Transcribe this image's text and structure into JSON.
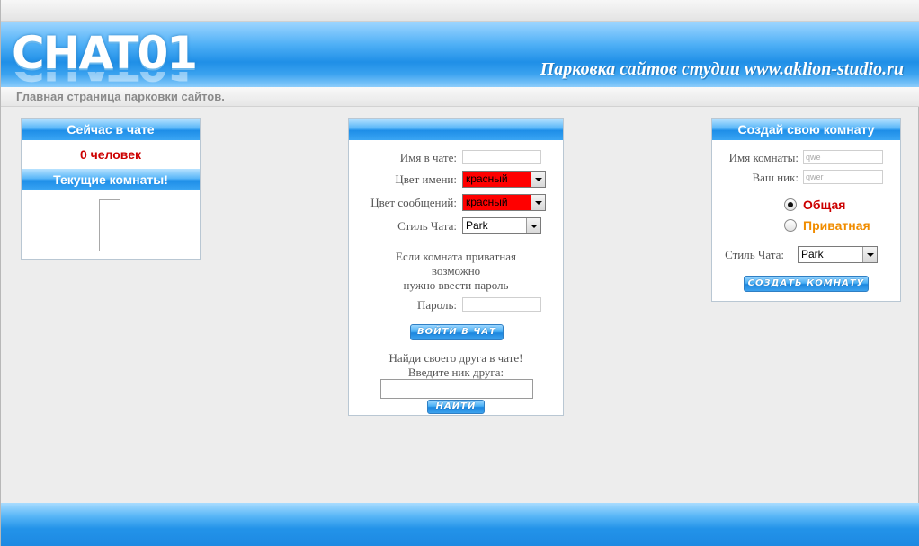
{
  "header": {
    "logo": "CHAT01",
    "slogan": "Парковка сайтов студии www.aklion-studio.ru"
  },
  "subbar": {
    "text": "Главная страница парковки сайтов."
  },
  "left": {
    "now_title": "Сейчас в чате",
    "count": "0 человек",
    "rooms_title": "Текущие комнаты!"
  },
  "center": {
    "title": "",
    "name_label": "Имя в чате:",
    "name_value": "",
    "name_color_label": "Цвет имени:",
    "name_color_value": "красный",
    "msg_color_label": "Цвет сообщений:",
    "msg_color_value": "красный",
    "style_label": "Стиль Чата:",
    "style_value": "Park",
    "private_note_1": "Если комната приватная",
    "private_note_2": "возможно",
    "private_note_3": "нужно ввести пароль",
    "password_label": "Пароль:",
    "enter_button": "ВОЙТИ В ЧАТ",
    "find_line_1": "Найди своего друга в чате!",
    "find_line_2": "Введите ник друга:",
    "find_button": "НАЙТИ"
  },
  "right": {
    "title": "Создай свою комнату",
    "room_label": "Имя комнаты:",
    "room_value": "qwe",
    "nick_label": "Ваш ник:",
    "nick_value": "qwer",
    "public_label": "Общая",
    "private_label": "Приватная",
    "style_label": "Стиль Чата:",
    "style_value": "Park",
    "create_button": "СОЗДАТЬ КОМНАТУ"
  },
  "colors": {
    "accent_blue": "#1e8ee8",
    "count_red": "#cc0000",
    "public_red": "#cc0000",
    "private_orange": "#f08c00",
    "select_red": "#ff0000"
  }
}
